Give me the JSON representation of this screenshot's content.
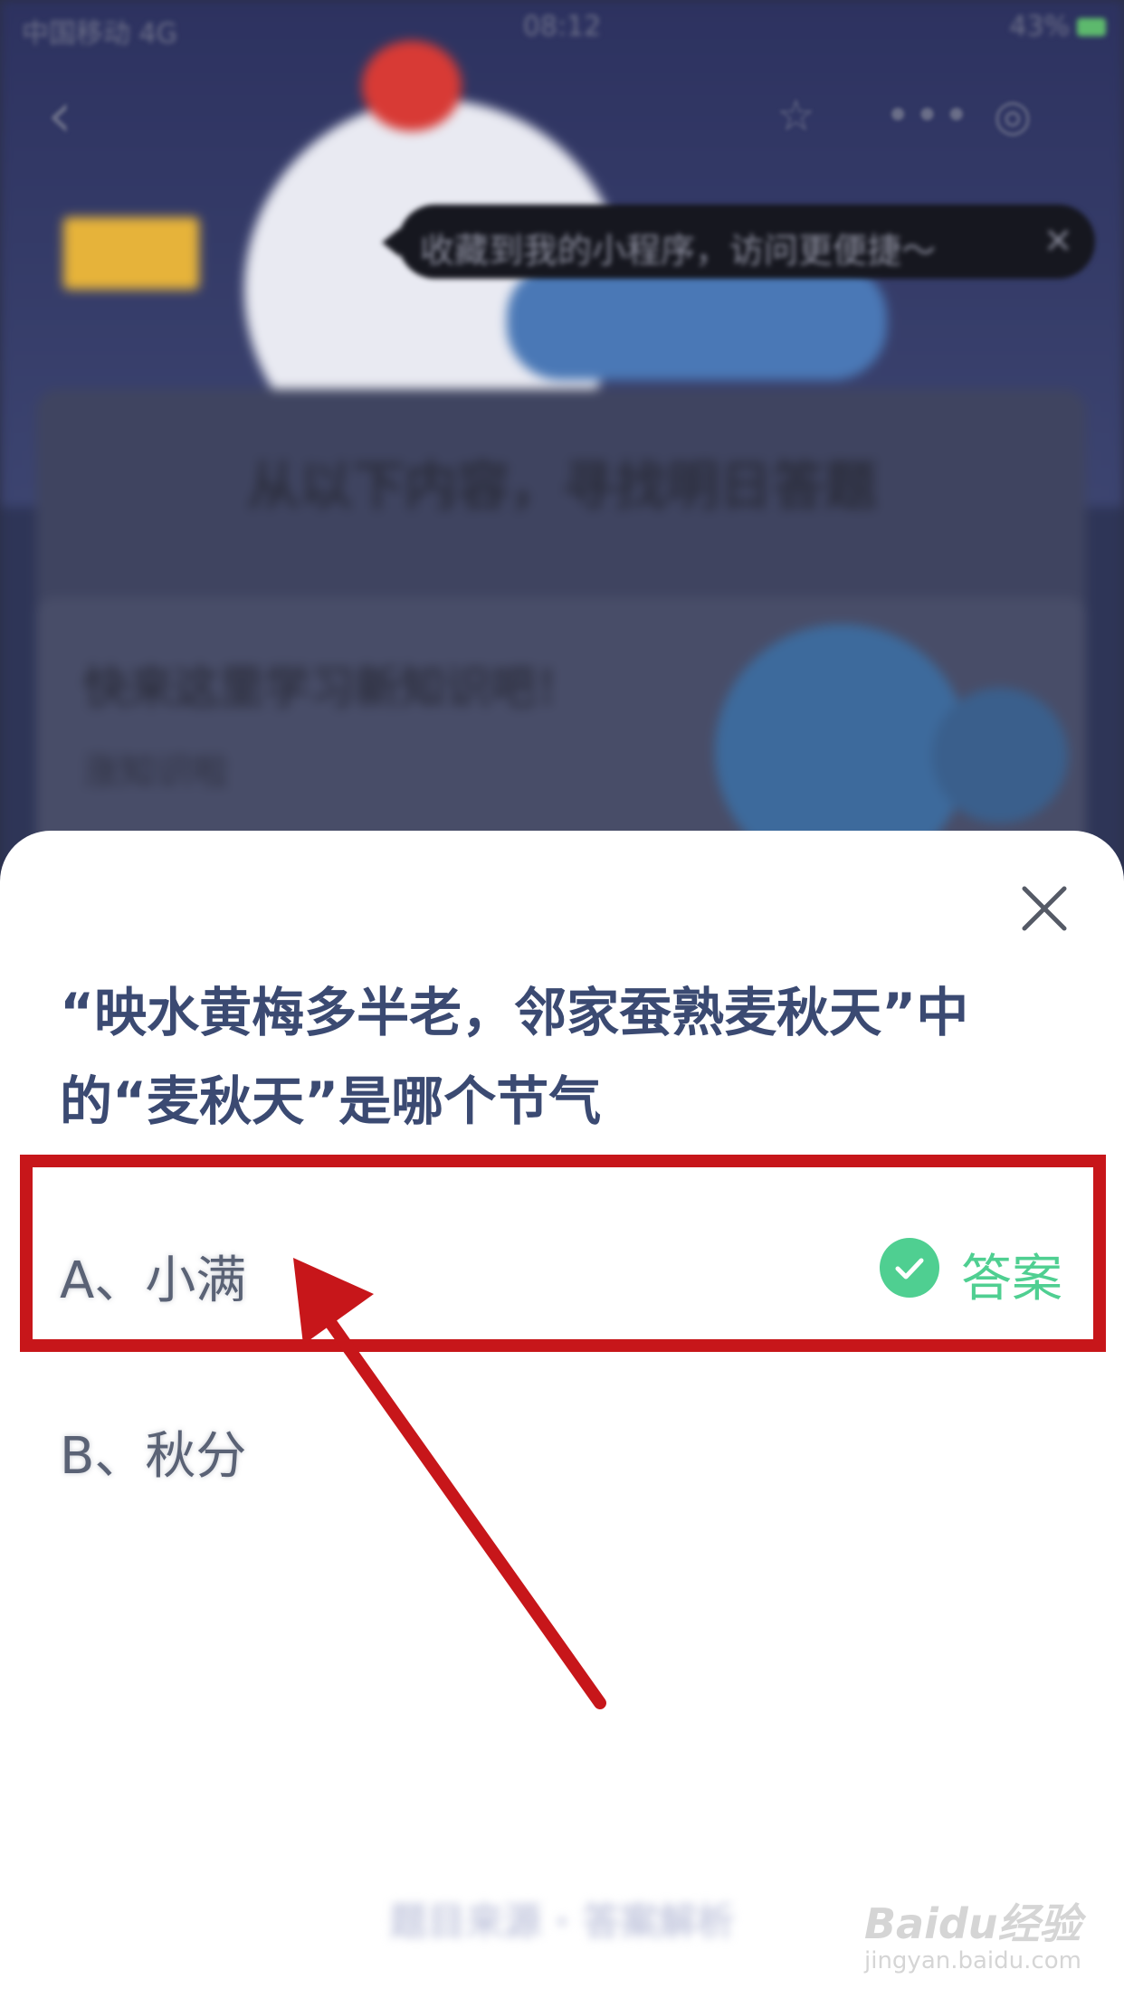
{
  "status_bar": {
    "carrier": "中国移动 4G",
    "time": "08:12",
    "battery": "43%"
  },
  "background": {
    "tooltip_text": "收藏到我的小程序，访问更便捷～",
    "tooltip_close": "×",
    "content_title": "从以下内容，寻找明日答题",
    "card_title": "快来这里学习新知识吧！",
    "card_subtitle": "涨知识啦",
    "bottom_link": "题目来源 · 答案解析"
  },
  "icons": {
    "back": "chevron-left-icon",
    "star": "star-icon",
    "more": "more-icon",
    "target": "target-icon",
    "close": "close-icon",
    "check": "check-icon"
  },
  "sheet": {
    "question": "“映水黄梅多半老，邻家蚕熟麦秋天”中的“麦秋天”是哪个节气",
    "options": [
      {
        "label": "A、小满",
        "is_answer": true
      },
      {
        "label": "B、秋分",
        "is_answer": false
      }
    ],
    "answer_label": "答案"
  },
  "colors": {
    "highlight": "#c7161a",
    "answer_green": "#4fcf91",
    "question_text": "#3b4a72"
  },
  "watermark": {
    "logo": "Baidu经验",
    "url": "jingyan.baidu.com"
  }
}
